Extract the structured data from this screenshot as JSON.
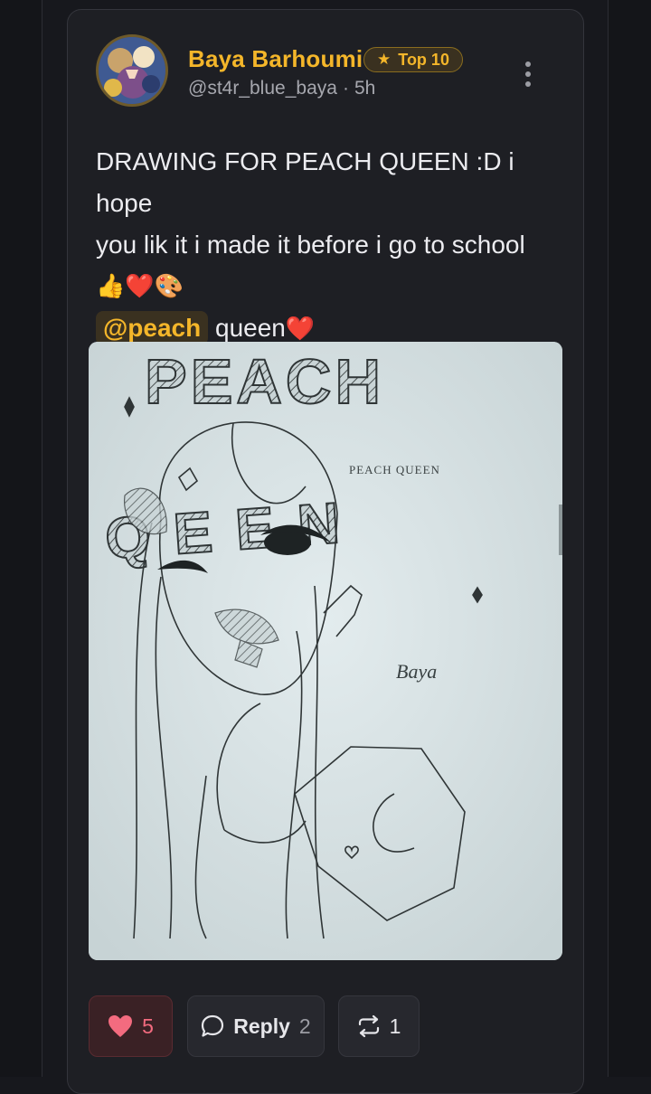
{
  "post": {
    "author_name": "Baya Barhoumi",
    "badge_label": "Top 10",
    "handle": "@st4r_blue_baya",
    "time_ago": "5h",
    "text_line1": "DRAWING FOR PEACH QUEEN :D i hope",
    "text_line2": "you lik it i made it before i go to school",
    "emoji_line": "👍❤️🎨",
    "mention": "@peach",
    "text_after_mention": "queen",
    "heart_emoji": "❤️"
  },
  "drawing": {
    "title_top": "PEACH",
    "small_caption": "PEACH QUEEN",
    "title_bottom": "QEEN",
    "signature": "Baya"
  },
  "actions": {
    "like_count": "5",
    "reply_label": "Reply",
    "reply_count": "2",
    "repost_count": "1"
  },
  "colors": {
    "accent_gold": "#f4b62a",
    "like_red": "#f36b7f",
    "card_bg": "#1e1f24",
    "page_bg": "#17181d"
  },
  "icons": [
    "star-icon",
    "more-vertical-icon",
    "heart-icon",
    "comment-icon",
    "repost-icon"
  ]
}
